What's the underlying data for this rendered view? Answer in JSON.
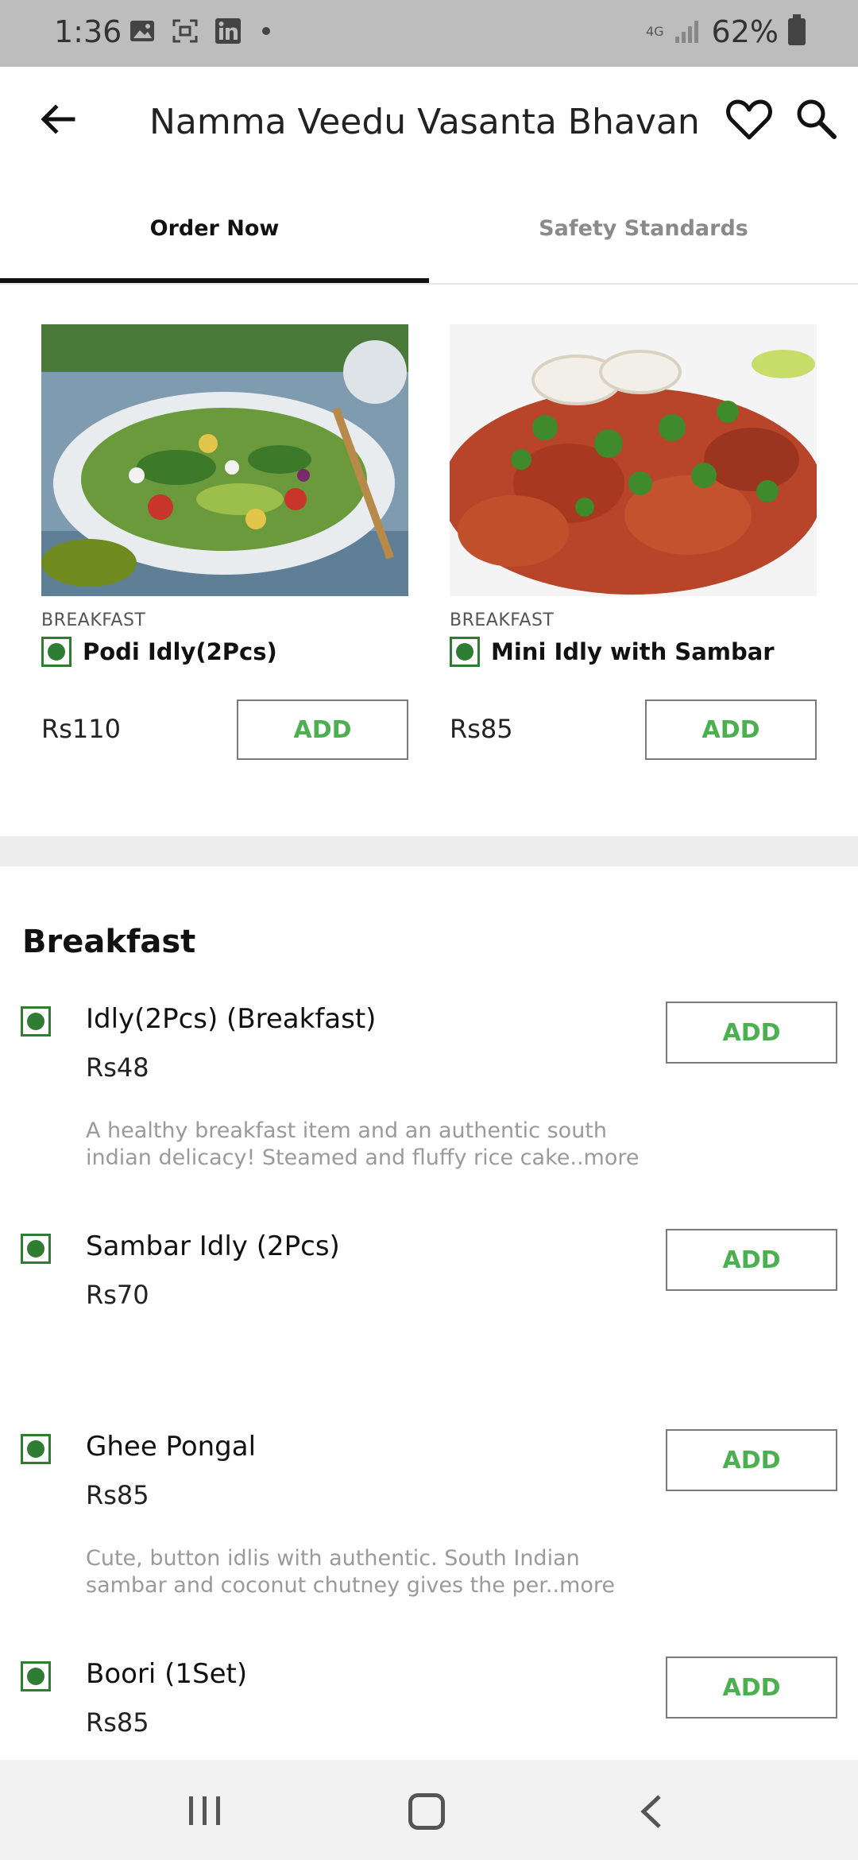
{
  "status_bar": {
    "time": "1:36",
    "network": "4G",
    "battery": "62%"
  },
  "app_bar": {
    "title": "Namma Veedu Vasanta Bhavan",
    "icons": [
      "back-arrow-icon",
      "heart-icon",
      "search-icon"
    ]
  },
  "tabs": [
    {
      "label": "Order Now",
      "active": true
    },
    {
      "label": "Safety Standards",
      "active": false
    }
  ],
  "featured": [
    {
      "category": "BREAKFAST",
      "name": "Podi Idly(2Pcs)",
      "price": "Rs110",
      "add_label": "ADD",
      "veg": true
    },
    {
      "category": "BREAKFAST",
      "name": "Mini Idly with Sambar",
      "price": "Rs85",
      "add_label": "ADD",
      "veg": true
    }
  ],
  "section": {
    "title": "Breakfast",
    "items": [
      {
        "name": "Idly(2Pcs) (Breakfast)",
        "price": "Rs48",
        "description": "A healthy breakfast item and an authentic south indian delicacy! Steamed and fluffy rice cake..more",
        "add_label": "ADD"
      },
      {
        "name": "Sambar Idly (2Pcs)",
        "price": "Rs70",
        "description": "",
        "add_label": "ADD"
      },
      {
        "name": "Ghee Pongal",
        "price": "Rs85",
        "description": "Cute, button idlis with authentic. South Indian sambar and coconut chutney gives the per..more",
        "add_label": "ADD"
      },
      {
        "name": "Boori (1Set)",
        "price": "Rs85",
        "description": "",
        "add_label": "ADD"
      }
    ]
  },
  "colors": {
    "accent_green": "#4caf50",
    "veg_green": "#2e7d32",
    "status_bar": "#bdbdbd"
  }
}
